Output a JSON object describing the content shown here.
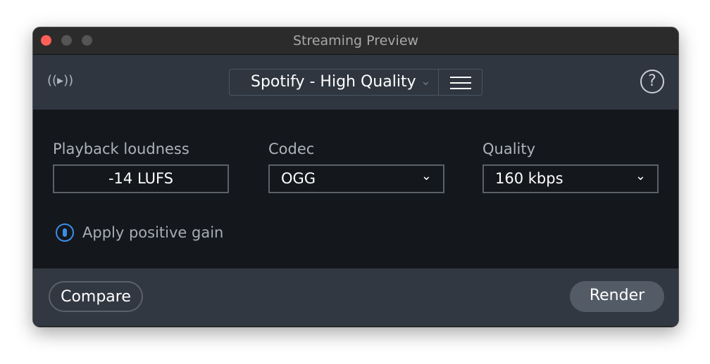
{
  "window": {
    "title": "Streaming Preview"
  },
  "toolbar": {
    "preset": "Spotify - High Quality",
    "broadcast_icon": "((▸))",
    "help": "?"
  },
  "fields": {
    "loudness": {
      "label": "Playback loudness",
      "value": "-14  LUFS"
    },
    "codec": {
      "label": "Codec",
      "value": "OGG"
    },
    "quality": {
      "label": "Quality",
      "value": "160 kbps"
    }
  },
  "options": {
    "apply_gain": "Apply positive gain"
  },
  "footer": {
    "compare": "Compare",
    "render": "Render"
  },
  "colors": {
    "accent": "#3b8eea",
    "close": "#fe5f57"
  }
}
